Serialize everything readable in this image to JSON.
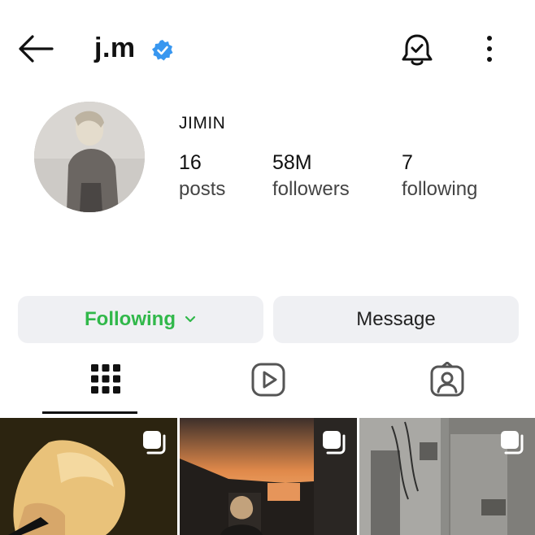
{
  "header": {
    "username": "j.m",
    "verified_color": "#3897f0"
  },
  "profile": {
    "display_name": "JIMIN",
    "stats": [
      {
        "value": "16",
        "label": "posts"
      },
      {
        "value": "58M",
        "label": "followers"
      },
      {
        "value": "7",
        "label": "following"
      }
    ]
  },
  "actions": {
    "following_label": "Following",
    "message_label": "Message",
    "following_color": "#31b84a"
  },
  "tabs": [
    {
      "icon": "grid-icon",
      "selected": true
    },
    {
      "icon": "reels-icon",
      "selected": false
    },
    {
      "icon": "tagged-icon",
      "selected": false
    }
  ],
  "posts": [
    {
      "type": "multi-image"
    },
    {
      "type": "multi-image"
    },
    {
      "type": "multi-image"
    }
  ]
}
